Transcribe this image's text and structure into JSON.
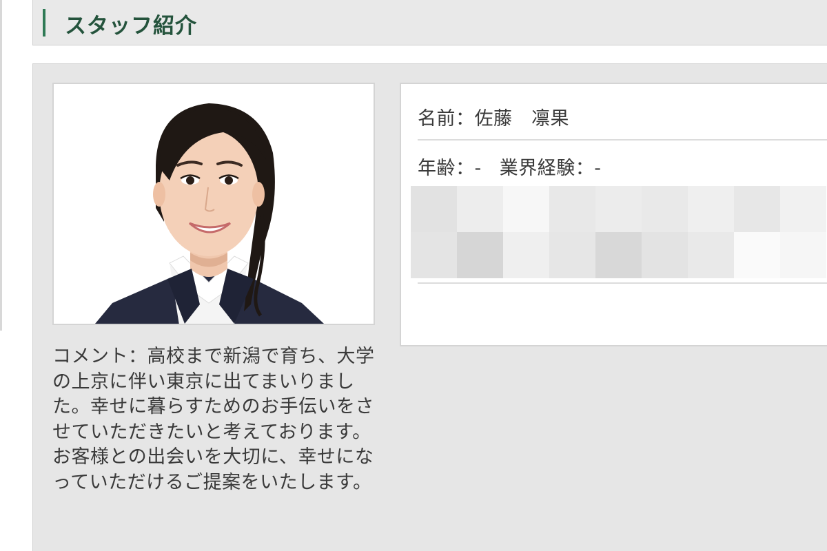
{
  "section": {
    "title": "スタッフ紹介"
  },
  "staff": {
    "name_label": "名前：",
    "name_value": "佐藤　凛果",
    "age_label": "年齢：",
    "age_value": "-",
    "experience_label": "業界経験：",
    "experience_value": "-",
    "comment_label": "コメント：",
    "comment_text": "高校まで新潟で育ち、大学の上京に伴い東京に出てまいりました。幸せに暮らすためのお手伝いをさせていただきたいと考えております。お客様との出会いを大切に、幸せになっていただけるご提案をいたします。"
  },
  "colors": {
    "accent": "#2f7a55",
    "title_text": "#24533c",
    "card_background": "#e6e6e6"
  },
  "icons": {
    "redacted_block": "pixelated-mosaic"
  }
}
